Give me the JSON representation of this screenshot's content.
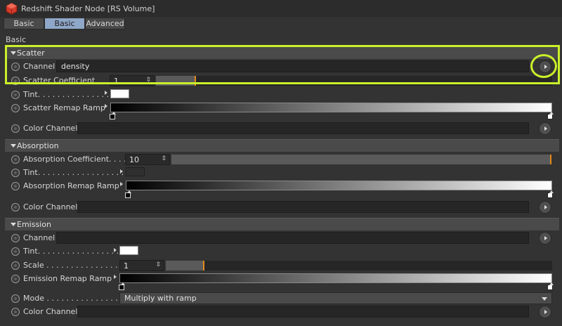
{
  "window": {
    "title": "Redshift Shader Node [RS Volume]"
  },
  "tabs": [
    {
      "label": "Basic",
      "active": false
    },
    {
      "label": "Basic",
      "active": true
    },
    {
      "label": "Advanced",
      "active": false
    }
  ],
  "section_label": "Basic",
  "scatter": {
    "header": "Scatter",
    "channel_label": "Channel",
    "channel_value": "density",
    "coefficient_label": "Scatter Coefficient",
    "coefficient_value": "1",
    "tint_label": "Tint. . . . . . . . . . . . . . .",
    "ramp_label": "Scatter Remap Ramp",
    "color_channel_label": "Color Channel"
  },
  "absorption": {
    "header": "Absorption",
    "coefficient_label": "Absorption Coefficient. . . .",
    "coefficient_value": "10",
    "tint_label": "Tint. . . . . . . . . . . . . . . . . . .",
    "ramp_label": "Absorption Remap Ramp",
    "color_channel_label": "Color Channel"
  },
  "emission": {
    "header": "Emission",
    "channel_label": "Channel",
    "tint_label": "Tint. . . . . . . . . . . . . . . . . . .",
    "scale_label": "Scale . . . . . . . . . . . . . . . . . .",
    "scale_value": "1",
    "ramp_label": "Emission Remap Ramp",
    "mode_label": "Mode . . . . . . . . . . . . . . . . . .",
    "mode_value": "Multiply with ramp",
    "color_channel_label": "Color Channel"
  },
  "colors": {
    "highlight": "#c9f02a",
    "active_tab": "#8fa7c8",
    "slider_handle": "#e08a1e"
  }
}
